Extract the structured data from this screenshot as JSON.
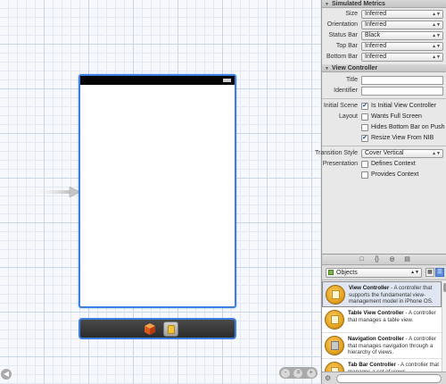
{
  "canvas": {
    "entry_arrow": "entry-point-arrow",
    "zoom_controls": [
      "-",
      "=",
      "+"
    ],
    "nav_left_icon": "arrow-left-icon"
  },
  "inspector": {
    "simulated_metrics": {
      "title": "Simulated Metrics",
      "rows": [
        {
          "label": "Size",
          "value": "Inferred"
        },
        {
          "label": "Orientation",
          "value": "Inferred"
        },
        {
          "label": "Status Bar",
          "value": "Black"
        },
        {
          "label": "Top Bar",
          "value": "Inferred"
        },
        {
          "label": "Bottom Bar",
          "value": "Inferred"
        }
      ]
    },
    "view_controller": {
      "title": "View Controller",
      "title_label": "Title",
      "identifier_label": "Identifier",
      "initial_scene_label": "Initial Scene",
      "initial_scene_checkbox": "Is Initial View Controller",
      "layout_label": "Layout",
      "layout_options": [
        {
          "label": "Wants Full Screen",
          "checked": false
        },
        {
          "label": "Hides Bottom Bar on Push",
          "checked": false
        },
        {
          "label": "Resize View From NIB",
          "checked": true
        }
      ],
      "transition_style_label": "Transition Style",
      "transition_style_value": "Cover Vertical",
      "presentation_label": "Presentation",
      "presentation_options": [
        {
          "label": "Defines Context",
          "checked": false
        },
        {
          "label": "Provides Context",
          "checked": false
        }
      ]
    }
  },
  "library": {
    "tabs": [
      "□",
      "{}",
      "◎",
      "▤"
    ],
    "selector": "Objects",
    "items": [
      {
        "name": "View Controller",
        "desc": " - A controller that supports the fundamental view-management model in iPhone OS."
      },
      {
        "name": "Table View Controller",
        "desc": " - A controller that manages a table view."
      },
      {
        "name": "Navigation Controller",
        "desc": " - A controller that manages navigation through a hierarchy of views."
      },
      {
        "name": "Tab Bar Controller",
        "desc": " - A controller that manages a set of views"
      }
    ]
  }
}
